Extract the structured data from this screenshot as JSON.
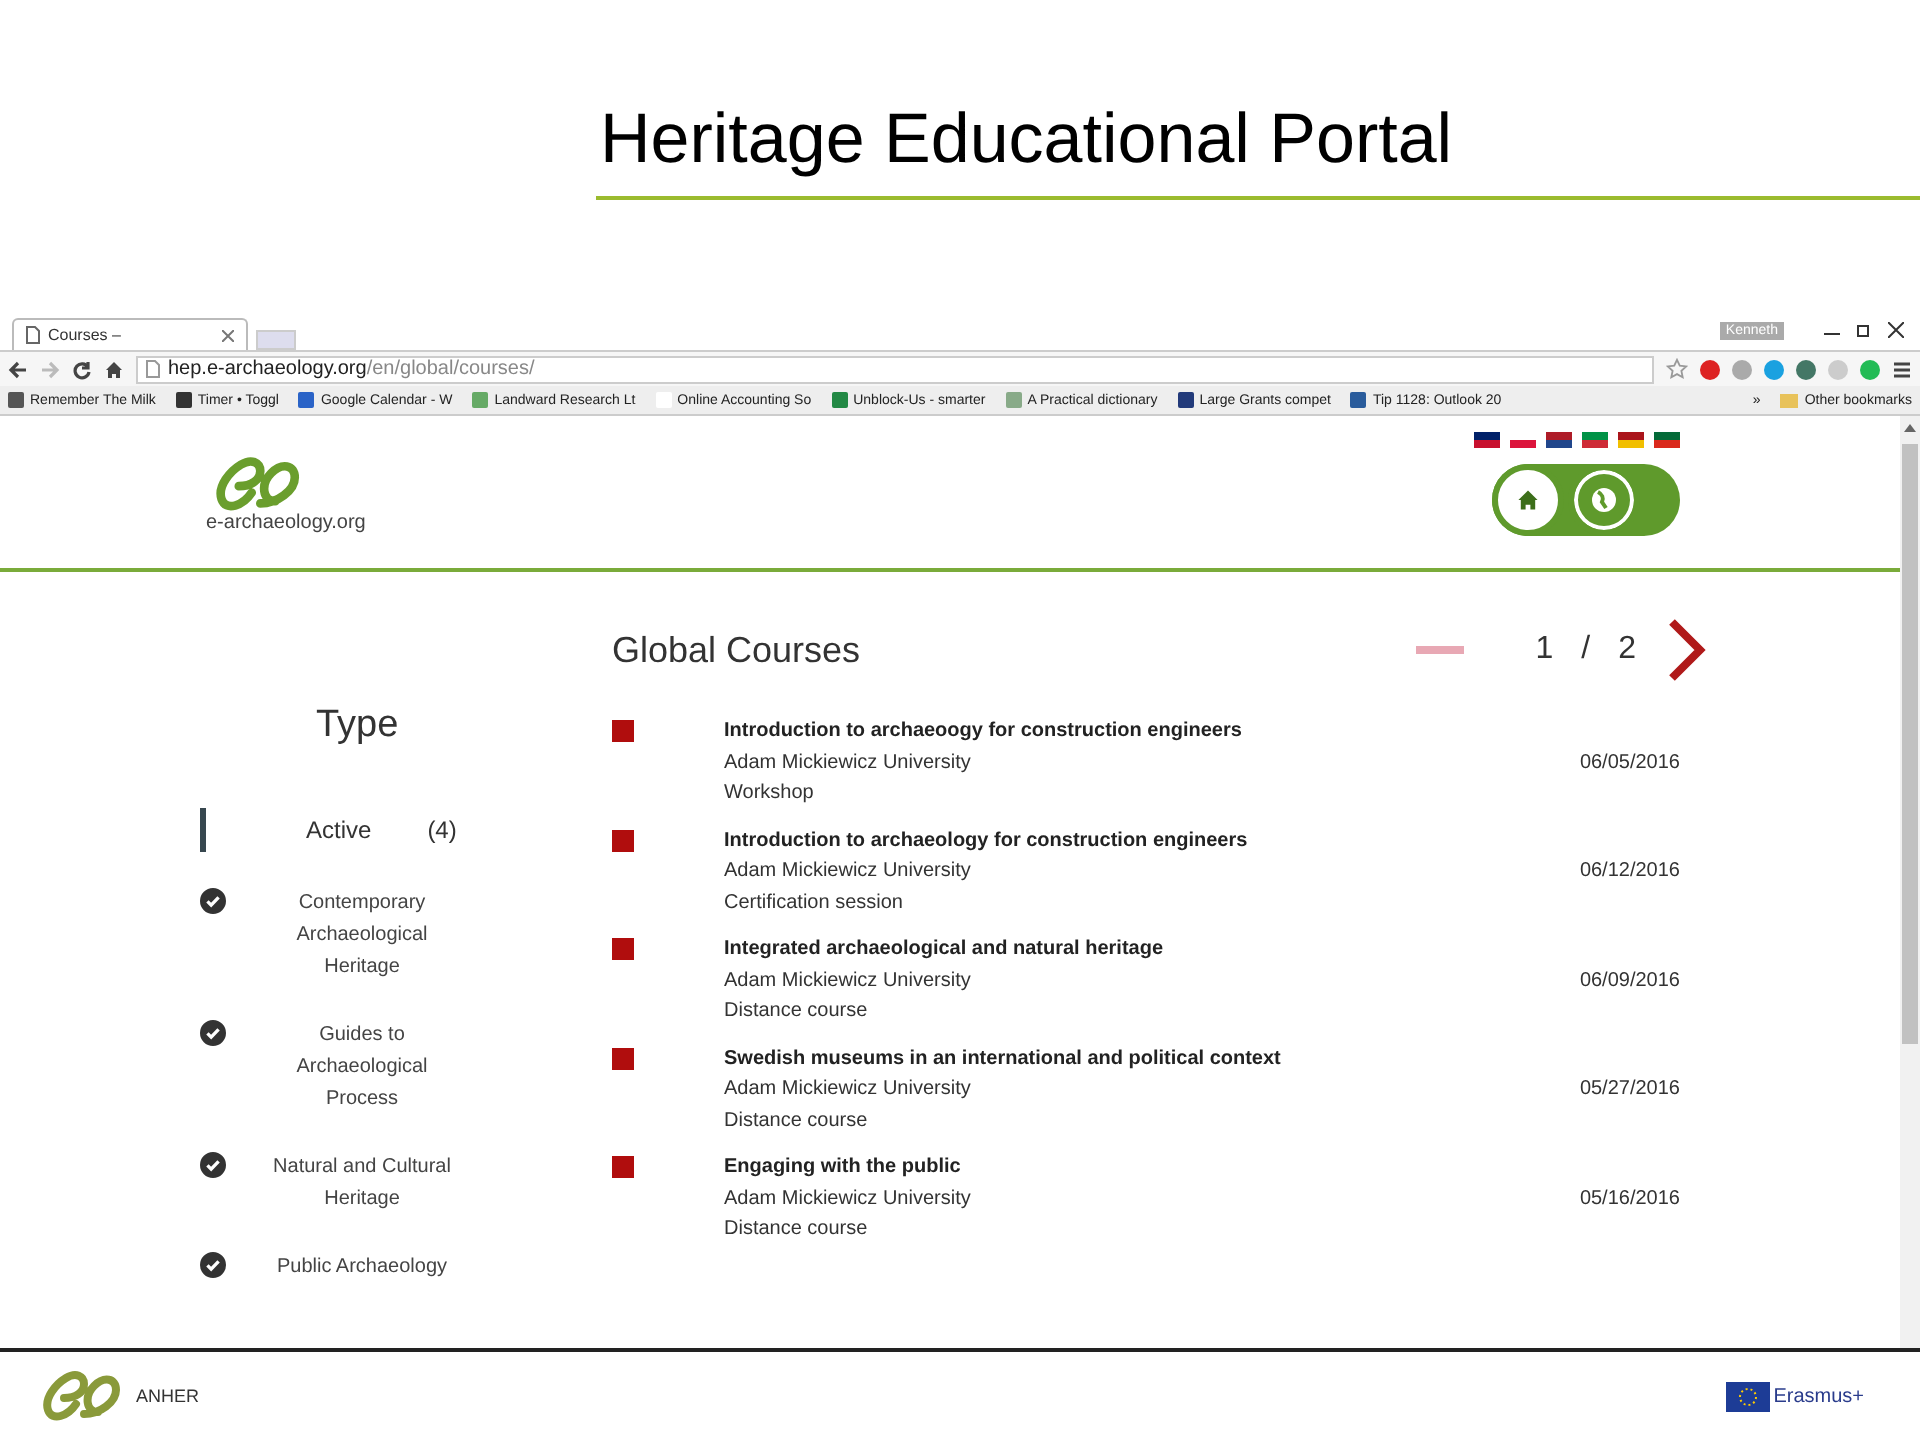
{
  "slide": {
    "title": "Heritage Educational Portal"
  },
  "browser": {
    "tab": {
      "title": "Courses –",
      "selected": true
    },
    "user": "Kenneth",
    "url_host": "hep.e-archaeology.org",
    "url_path": "/en/global/courses/",
    "bookmarks": [
      {
        "label": "Remember The Milk"
      },
      {
        "label": "Timer • Toggl"
      },
      {
        "label": "Google Calendar - W"
      },
      {
        "label": "Landward Research Lt"
      },
      {
        "label": "Online Accounting So"
      },
      {
        "label": "Unblock-Us - smarter"
      },
      {
        "label": "A Practical dictionary"
      },
      {
        "label": "Large Grants compet"
      },
      {
        "label": "Tip 1128: Outlook 20"
      }
    ],
    "overflow": "»",
    "other_bookmarks": "Other bookmarks"
  },
  "site": {
    "logo_text": "e-archaeology.org",
    "nav": [
      {
        "kind": "home",
        "selected": true
      },
      {
        "kind": "globe",
        "selected": false
      }
    ],
    "section_title": "Global Courses",
    "pager": {
      "current": "1",
      "separator": "/",
      "total": "2",
      "prev_disabled": true
    },
    "filter": {
      "title": "Type",
      "group": "Active",
      "count": "(4)",
      "items": [
        {
          "label": "Contemporary Archaeological Heritage",
          "checked": true
        },
        {
          "label": "Guides to Archaeological Process",
          "checked": true
        },
        {
          "label": "Natural and Cultural Heritage",
          "checked": true
        },
        {
          "label": "Public Archaeology",
          "checked": true
        }
      ]
    },
    "courses": [
      {
        "title": "Introduction to archaeoogy for construction engineers",
        "institution": "Adam Mickiewicz University",
        "type": "Workshop",
        "date": "06/05/2016"
      },
      {
        "title": "Introduction to archaeology for construction engineers",
        "institution": "Adam Mickiewicz University",
        "type": "Certification session",
        "date": "06/12/2016"
      },
      {
        "title": "Integrated archaeological and natural heritage",
        "institution": "Adam Mickiewicz University",
        "type": "Distance course",
        "date": "06/09/2016"
      },
      {
        "title": "Swedish museums in an international and political context",
        "institution": "Adam Mickiewicz University",
        "type": "Distance course",
        "date": "05/27/2016"
      },
      {
        "title": "Engaging with the public",
        "institution": "Adam Mickiewicz University",
        "type": "Distance course",
        "date": "05/16/2016"
      }
    ]
  },
  "footer": {
    "left": "ANHER",
    "right": "Erasmus+"
  }
}
